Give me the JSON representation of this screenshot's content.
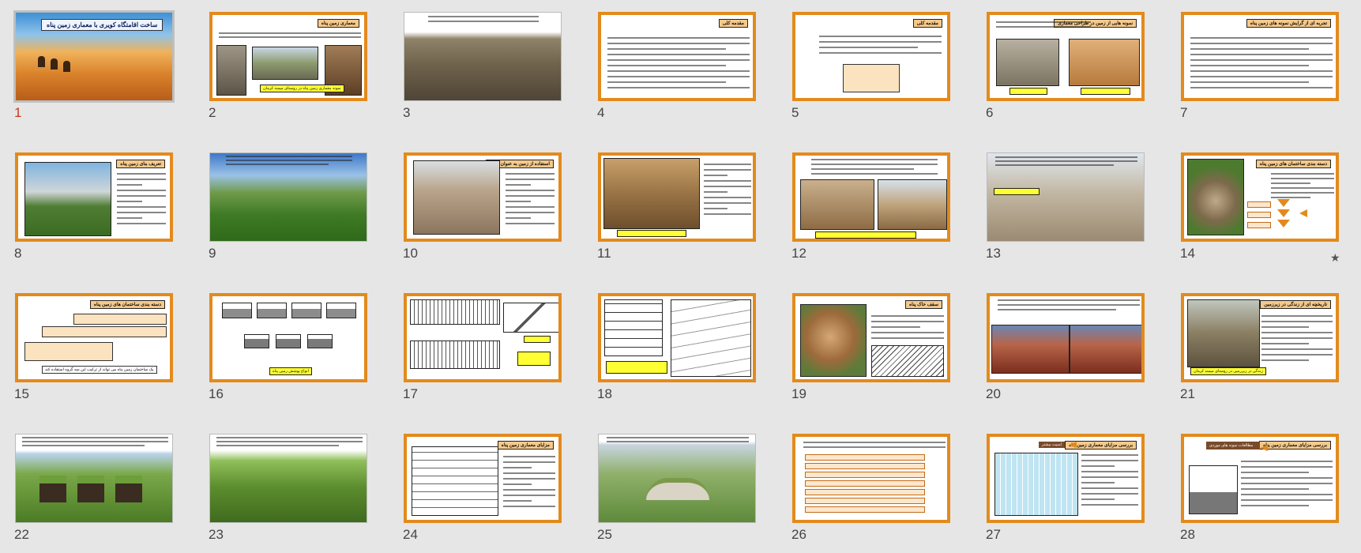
{
  "slide_sorter": {
    "selected_slide": "1",
    "slides": [
      {
        "number": "1",
        "title": "ساخت اقامتگاه کویری با معماری زمین پناه",
        "style": "desert"
      },
      {
        "number": "2",
        "title": "معماری زمین پناه",
        "caption": "نمونه معماری زمین پناه در روستای میمند کرمان",
        "style": "three-photos"
      },
      {
        "number": "3",
        "style": "photo-rocky"
      },
      {
        "number": "4",
        "title": "مقدمه کلی",
        "style": "text"
      },
      {
        "number": "5",
        "title": "مقدمه کلی",
        "style": "text-box"
      },
      {
        "number": "6",
        "title": "نمونه هایی از زمین در طراحی معماری",
        "style": "two-photos"
      },
      {
        "number": "7",
        "title": "تجربه ای از گرایش نمونه های زمین پناه",
        "style": "text"
      },
      {
        "number": "8",
        "title": "تعریف بنای زمین پناه",
        "style": "left-photo"
      },
      {
        "number": "9",
        "style": "photo-green"
      },
      {
        "number": "10",
        "title": "استفاده از زمین به عنوان عایق",
        "style": "left-photo-dune"
      },
      {
        "number": "11",
        "style": "photo-courtyard"
      },
      {
        "number": "12",
        "style": "two-photos-top"
      },
      {
        "number": "13",
        "style": "photo-city"
      },
      {
        "number": "14",
        "title": "دسته بندی ساختمان های زمین پناه",
        "style": "diagram-arrows"
      },
      {
        "number": "15",
        "title": "دسته بندی ساختمان های زمین پناه",
        "caption": "یک ساختمان زمین پناه می تواند از ترکیب این سه گروه استفاده کند",
        "style": "boxes"
      },
      {
        "number": "16",
        "caption": "انواع پوشش زمین پناه",
        "style": "sections"
      },
      {
        "number": "17",
        "style": "plans"
      },
      {
        "number": "18",
        "style": "sketches"
      },
      {
        "number": "19",
        "title": "سقف خاک پناه",
        "style": "left-sketch"
      },
      {
        "number": "20",
        "style": "photo-red"
      },
      {
        "number": "21",
        "title": "تاریخچه ای از زندگی در زیرزمین",
        "caption": "زندگی در زیرزمین در روستای میمند کرمان",
        "style": "left-photo-village"
      },
      {
        "number": "22",
        "style": "photo-grass"
      },
      {
        "number": "23",
        "style": "photo-hill"
      },
      {
        "number": "24",
        "title": "مزایای معماری زمین پناه",
        "style": "left-diagram"
      },
      {
        "number": "25",
        "style": "photo-modern"
      },
      {
        "number": "26",
        "style": "list-boxes"
      },
      {
        "number": "27",
        "title": "بررسی مزایای معماری زمین پناه",
        "label": "امنیت بیشتر",
        "style": "diagram-house"
      },
      {
        "number": "28",
        "title": "بررسی مزایای معماری زمین پناه",
        "label": "مطالعات نمونه های موردی",
        "style": "diagram-chair"
      }
    ]
  },
  "icons": {
    "animation_star": "★"
  },
  "colors": {
    "slide_border": "#e38a1c",
    "selected_border": "#8a1c22",
    "caption_fill": "#ffff33",
    "title_fill": "#f6c98a"
  }
}
